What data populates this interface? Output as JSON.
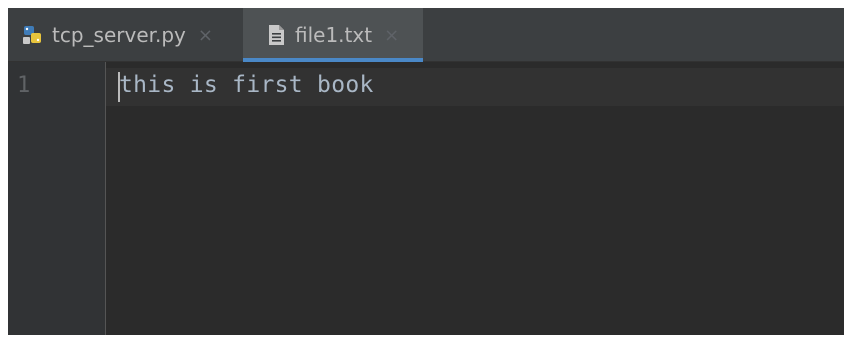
{
  "tabs": [
    {
      "label": "tcp_server.py",
      "icon": "python-file-icon",
      "close": "×",
      "active": false
    },
    {
      "label": "file1.txt",
      "icon": "text-file-icon",
      "close": "×",
      "active": true
    }
  ],
  "editor": {
    "line_number": "1",
    "code": "this is first book"
  },
  "colors": {
    "accent": "#4a88c7",
    "background": "#2b2b2b",
    "text": "#a9b7c6"
  }
}
